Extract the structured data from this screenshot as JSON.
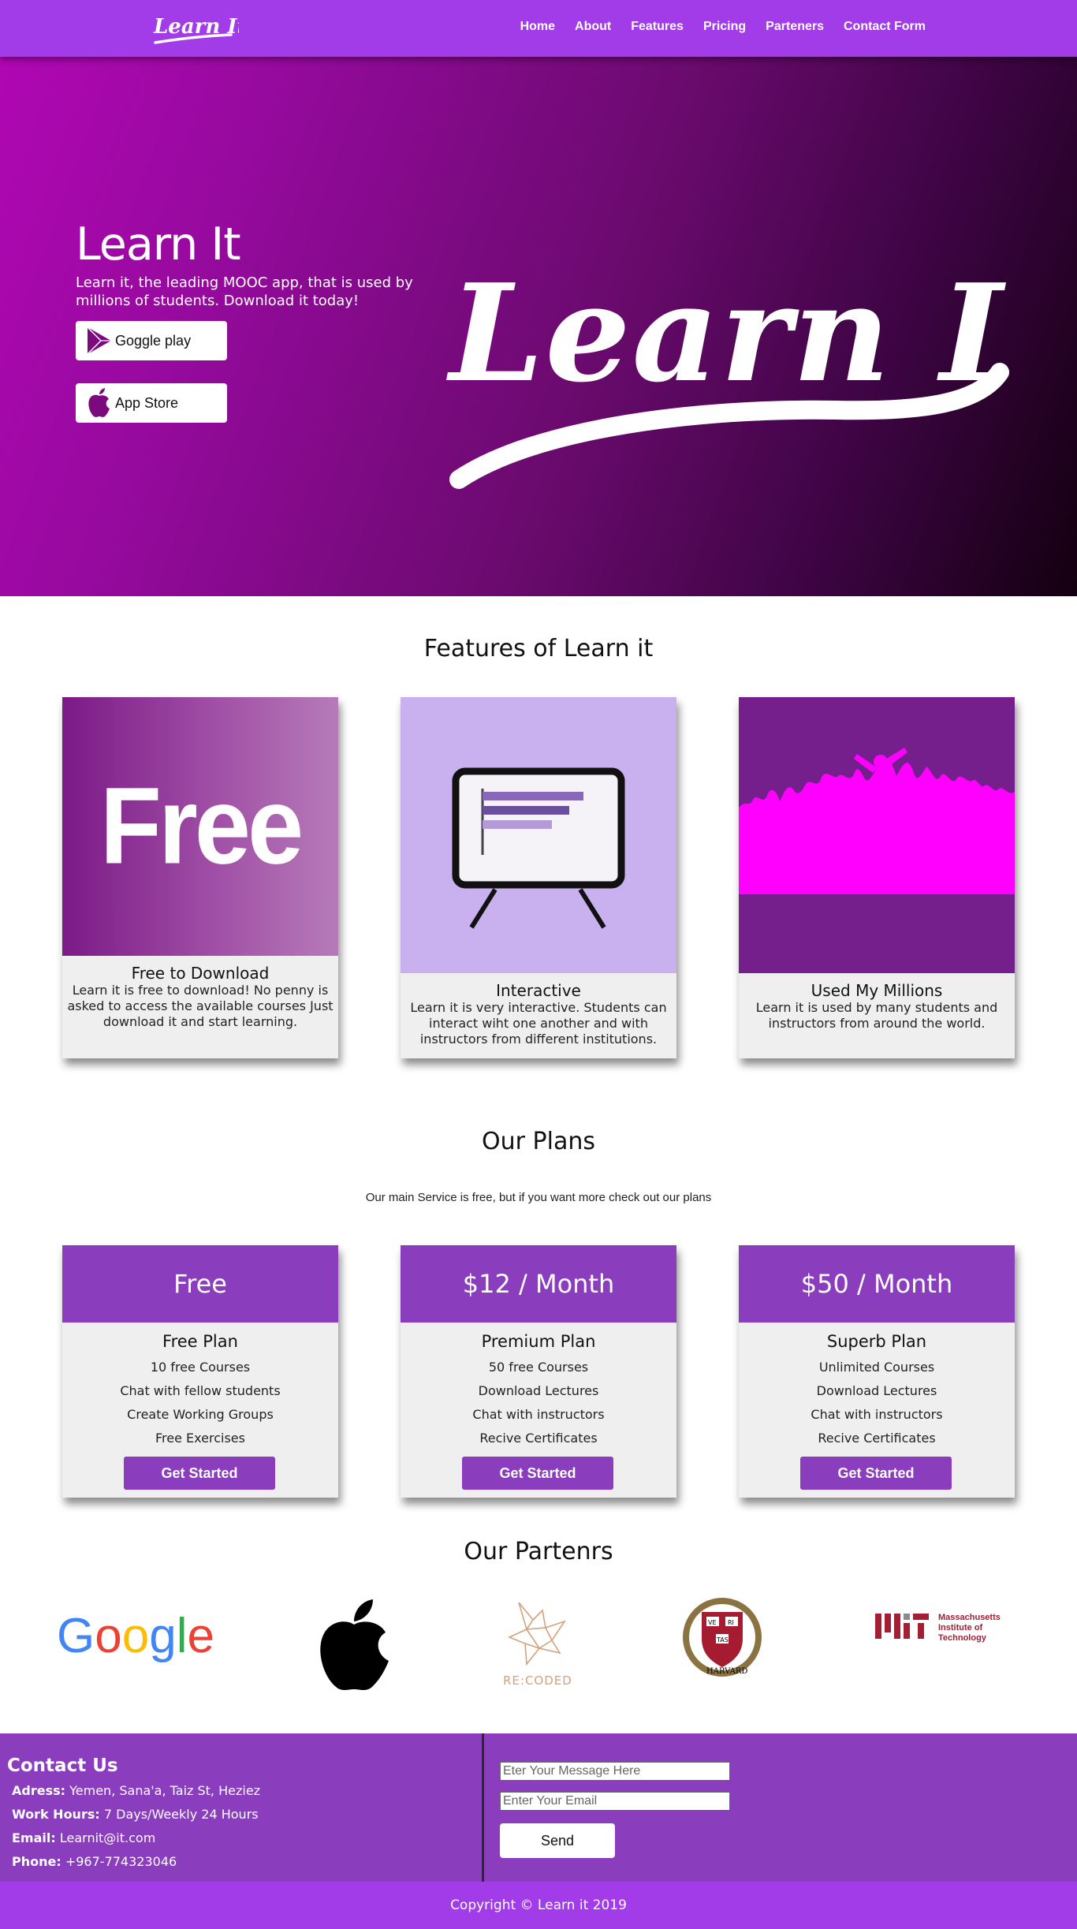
{
  "nav": {
    "logo_text": "Learn It",
    "links": [
      "Home",
      "About",
      "Features",
      "Pricing",
      "Parteners",
      "Contact Form"
    ]
  },
  "hero": {
    "title": "Learn It",
    "subtitle": "Learn it, the leading MOOC app, that is used by millions of students. Download it today!",
    "google_play_label": "Goggle play",
    "app_store_label": "App Store",
    "logo_text": "Learn It"
  },
  "features": {
    "title": "Features of Learn it",
    "cards": [
      {
        "image_text": "Free",
        "heading": "Free to Download",
        "text": "Learn it is free to download! No penny is asked to access the available courses Just download it and start learning."
      },
      {
        "heading": "Interactive",
        "text": "Learn it is very interactive. Students can interact wiht one another and with instructors from different institutions."
      },
      {
        "heading": "Used My Millions",
        "text": "Learn it is used by many students and instructors from around the world."
      }
    ]
  },
  "plans": {
    "title": "Our Plans",
    "subtitle": "Our main Service is free, but if you want more check out our plans",
    "cards": [
      {
        "price": "Free",
        "name": "Free Plan",
        "features": [
          "10 free Courses",
          "Chat with fellow students",
          "Create Working Groups",
          "Free Exercises"
        ],
        "button": "Get Started"
      },
      {
        "price": "$12 / Month",
        "name": "Premium Plan",
        "features": [
          "50 free Courses",
          "Download Lectures",
          "Chat with instructors",
          "Recive Certificates"
        ],
        "button": "Get Started"
      },
      {
        "price": "$50 / Month",
        "name": "Superb Plan",
        "features": [
          "Unlimited Courses",
          "Download Lectures",
          "Chat with instructors",
          "Recive Certificates"
        ],
        "button": "Get Started"
      }
    ]
  },
  "partners": {
    "title": "Our Partenrs",
    "google": "Google",
    "recoded": "RE:CODED",
    "harvard": "HARVARD",
    "harvard_shield": [
      "VE",
      "RI",
      "TAS"
    ],
    "mit_mark": "MIT",
    "mit_name": [
      "Massachusetts",
      "Institute of",
      "Technology"
    ]
  },
  "contact": {
    "title": "Contact Us",
    "address_label": "Adress:",
    "address": "Yemen, Sana'a, Taiz St, Heziez",
    "hours_label": "Work Hours:",
    "hours": "7 Days/Weekly 24 Hours",
    "email_label": "Email:",
    "email": "Learnit@it.com",
    "phone_label": "Phone:",
    "phone": "+967-774323046",
    "message_placeholder": "Eter Your Message Here",
    "email_placeholder": "Enter Your Email",
    "send_label": "Send"
  },
  "footer": {
    "copyright": "Copyright © Learn it 2019"
  },
  "colors": {
    "nav": "#a23be8",
    "accent": "#8a3dbc",
    "hero_start": "#b007b3",
    "hero_end": "#140010",
    "magenta": "#ff00ff"
  }
}
